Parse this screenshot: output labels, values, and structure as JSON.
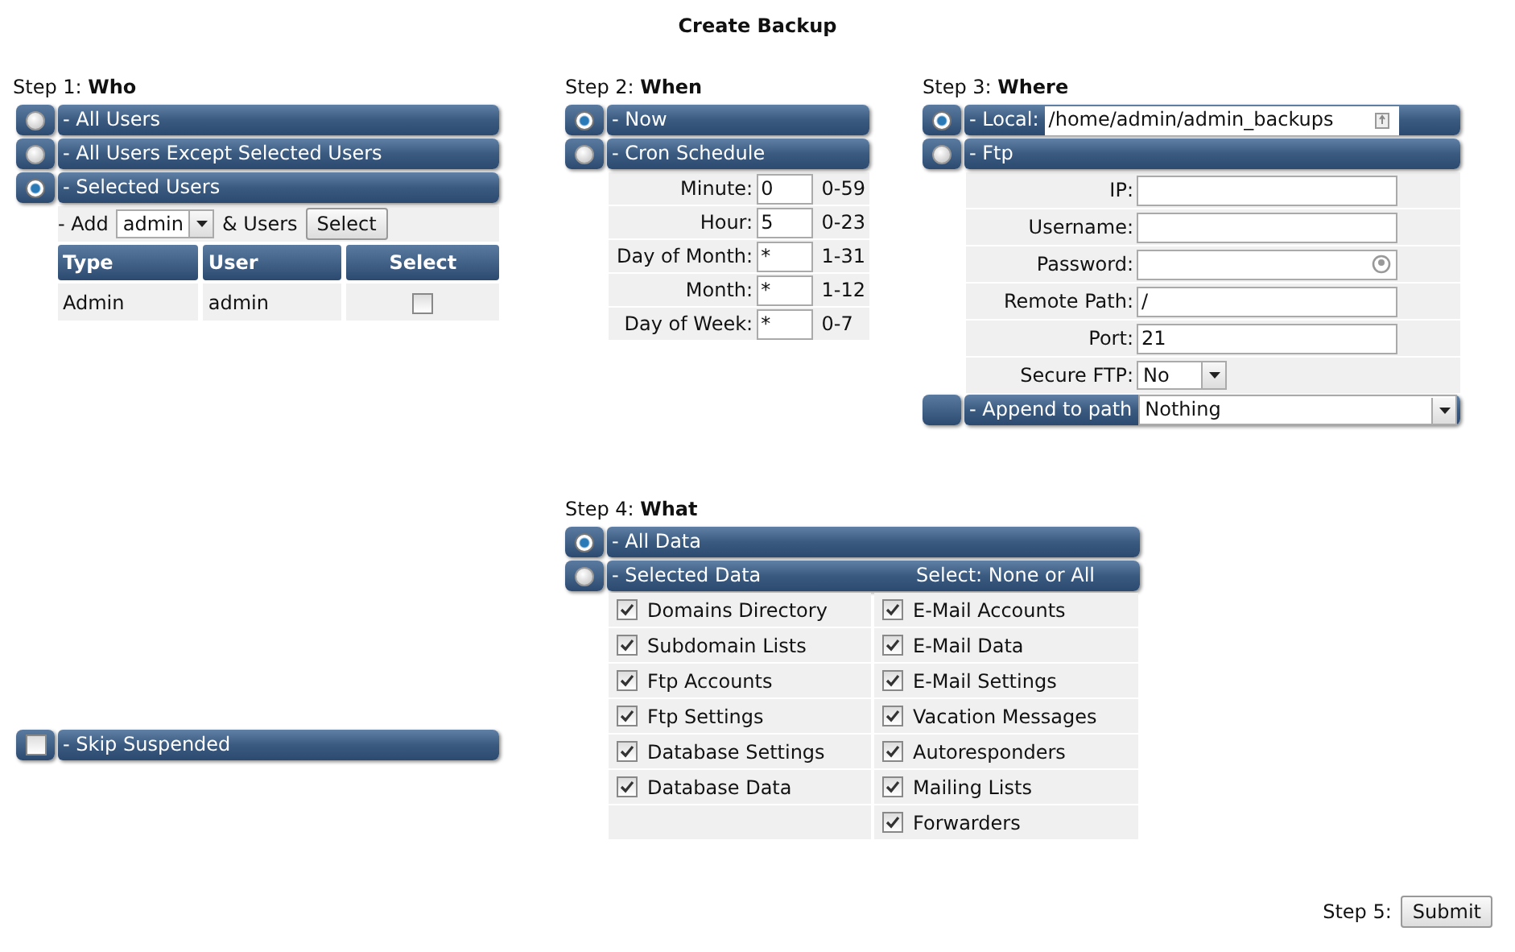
{
  "title": "Create Backup",
  "who": {
    "heading": "Step 1: **Who**",
    "options": [
      {
        "label": "- All Users",
        "selected": false
      },
      {
        "label": "- All Users Except Selected Users",
        "selected": false
      },
      {
        "label": "- Selected Users",
        "selected": true
      }
    ],
    "add_label": "- Add",
    "user_select": "admin",
    "users_label": "& Users",
    "select_button": "Select",
    "table": {
      "columns": [
        "Type",
        "User",
        "Select"
      ],
      "rows": [
        {
          "type": "Admin",
          "user": "admin",
          "checked": false
        }
      ]
    }
  },
  "when": {
    "heading": "Step 2: **When**",
    "options": [
      {
        "label": "- Now",
        "selected": true
      },
      {
        "label": "- Cron Schedule",
        "selected": false
      }
    ],
    "cron": [
      {
        "label": "Minute:",
        "value": "0",
        "range": "0-59"
      },
      {
        "label": "Hour:",
        "value": "5",
        "range": "0-23"
      },
      {
        "label": "Day of Month:",
        "value": "*",
        "range": "1-31"
      },
      {
        "label": "Month:",
        "value": "*",
        "range": "1-12"
      },
      {
        "label": "Day of Week:",
        "value": "*",
        "range": "0-7"
      }
    ]
  },
  "where": {
    "heading": "Step 3: **Where**",
    "local": {
      "label": "- Local:",
      "value": "/home/admin/admin_backups",
      "selected": true
    },
    "ftp": {
      "label": "- Ftp",
      "selected": false
    },
    "ftp_fields": [
      {
        "label": "IP:",
        "kind": "text"
      },
      {
        "label": "Username:",
        "kind": "text"
      },
      {
        "label": "Password:",
        "kind": "password"
      },
      {
        "label": "Remote Path:",
        "kind": "text",
        "value": "/"
      },
      {
        "label": "Port:",
        "kind": "text",
        "value": "21"
      },
      {
        "label": "Secure FTP:",
        "kind": "select",
        "value": "No"
      }
    ],
    "append": {
      "label": "- Append to path",
      "value": "Nothing"
    }
  },
  "what": {
    "heading": "Step 4: **What**",
    "options": [
      {
        "label": "- All Data",
        "selected": true
      },
      {
        "label": "- Selected Data",
        "selected": false,
        "select_label": "Select: None or All"
      }
    ],
    "columns": [
      [
        {
          "label": "Domains Directory",
          "checked": true
        },
        {
          "label": "Subdomain Lists",
          "checked": true
        },
        {
          "label": "Ftp Accounts",
          "checked": true
        },
        {
          "label": "Ftp Settings",
          "checked": true
        },
        {
          "label": "Database Settings",
          "checked": true
        },
        {
          "label": "Database Data",
          "checked": true
        }
      ],
      [
        {
          "label": "E-Mail Accounts",
          "checked": true
        },
        {
          "label": "E-Mail Data",
          "checked": true
        },
        {
          "label": "E-Mail Settings",
          "checked": true
        },
        {
          "label": "Vacation Messages",
          "checked": true
        },
        {
          "label": "Autoresponders",
          "checked": true
        },
        {
          "label": "Mailing Lists",
          "checked": true
        },
        {
          "label": "Forwarders",
          "checked": true
        }
      ]
    ]
  },
  "skip_suspended": {
    "label": "- Skip Suspended",
    "checked": false
  },
  "submit": {
    "label": "Step 5:",
    "button": "Submit"
  }
}
